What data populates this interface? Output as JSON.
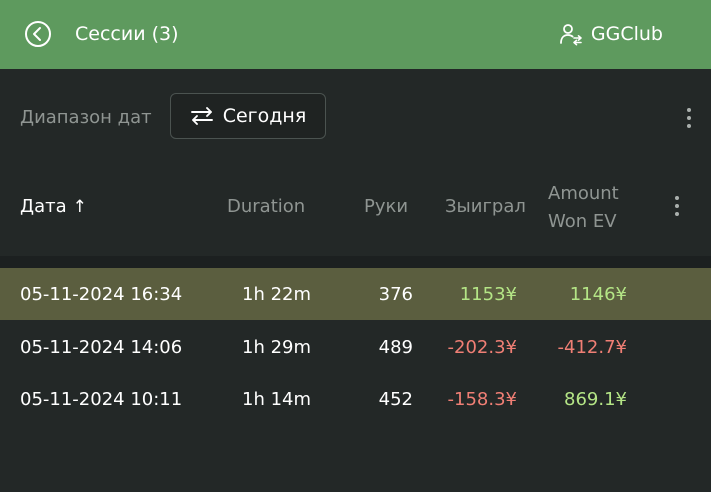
{
  "header": {
    "back_icon": "back-circle-icon",
    "title": "Сессии (3)",
    "club_icon": "user-switch-icon",
    "club_name": "GGClub",
    "background_color": "#5e9a5e"
  },
  "filter": {
    "label": "Диапазон дат",
    "swap_icon": "swap-arrows-icon",
    "value": "Сегодня"
  },
  "table": {
    "columns": {
      "date": "Дата",
      "date_sort": "↑",
      "duration": "Duration",
      "hands": "Руки",
      "won": "Зыиграл",
      "won_ev": "Amount Won EV"
    },
    "rows": [
      {
        "date": "05-11-2024 16:34",
        "duration": "1h 22m",
        "hands": "376",
        "won": "1153¥",
        "won_ev": "1146¥",
        "selected": true
      },
      {
        "date": "05-11-2024 14:06",
        "duration": "1h 29m",
        "hands": "489",
        "won": "-202.3¥",
        "won_ev": "-412.7¥",
        "selected": false
      },
      {
        "date": "05-11-2024 10:11",
        "duration": "1h 14m",
        "hands": "452",
        "won": "-158.3¥",
        "won_ev": "869.1¥",
        "selected": false
      }
    ]
  },
  "colors": {
    "positive": "#b4e586",
    "negative": "#f07f75",
    "selected_row": "#5b5e3f",
    "background": "#232827"
  }
}
